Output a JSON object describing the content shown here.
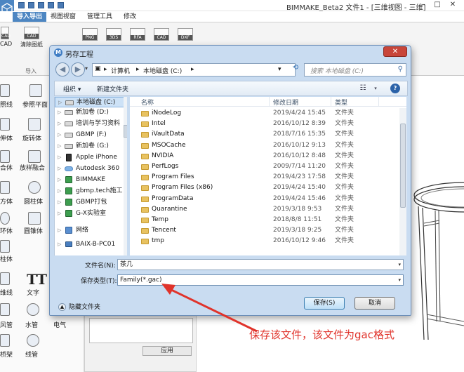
{
  "app": {
    "title": "BIMMAKE_Beta2 文件1 - [三维视图 - 三维]",
    "tabs": [
      "导入导出",
      "视图视窗",
      "管理工具",
      "修改"
    ],
    "active_tab": 0,
    "ribbon_buttons": [
      {
        "label": "CAD",
        "icon_tag": "CAD"
      },
      {
        "label": "清除图纸",
        "icon_tag": "CAD"
      },
      {
        "label": "",
        "icon_tag": "PNG"
      },
      {
        "label": "",
        "icon_tag": "3DS"
      },
      {
        "label": "",
        "icon_tag": "RFA"
      },
      {
        "label": "",
        "icon_tag": "CAD"
      },
      {
        "label": "",
        "icon_tag": "DXF"
      }
    ],
    "ribbon_group_label": "导入",
    "tools": [
      "照线",
      "参照平面",
      "伸体",
      "旋转体",
      "合体",
      "放样融合",
      "方体",
      "圆柱体",
      "环体",
      "圆锥体",
      "柱体",
      "维线",
      "文字",
      "风管",
      "水管",
      "电气",
      "桥架",
      "线管"
    ],
    "tt_glyph": "TT",
    "apply_button": "应用",
    "colors": {
      "accent": "#4d86c2",
      "annotation": "#e0332b"
    }
  },
  "dialog": {
    "title": "另存工程",
    "close_icon": "close-icon",
    "icon_letter": "M",
    "address_segments": [
      "计算机",
      "本地磁盘 (C:)"
    ],
    "search_placeholder": "搜索 本地磁盘 (C:)",
    "toolbar": {
      "organize": "组织 ▾",
      "new_folder": "新建文件夹"
    },
    "nav_items": [
      {
        "label": "本地磁盘 (C:)",
        "icon": "drive",
        "selected": true
      },
      {
        "label": "新加卷 (D:)",
        "icon": "drive"
      },
      {
        "label": "培训与学习资料",
        "icon": "drive"
      },
      {
        "label": "GBMP (F:)",
        "icon": "drive"
      },
      {
        "label": "新加卷 (G:)",
        "icon": "drive"
      },
      {
        "label": "Apple iPhone",
        "icon": "phone"
      },
      {
        "label": "Autodesk 360",
        "icon": "cloud"
      },
      {
        "label": "BIMMAKE",
        "icon": "app"
      },
      {
        "label": "gbmp.tech施工",
        "icon": "app"
      },
      {
        "label": "GBMP打包",
        "icon": "app"
      },
      {
        "label": "G-X实验室",
        "icon": "app"
      },
      {
        "label": "网络",
        "icon": "net"
      },
      {
        "label": "BAIX-B-PC01",
        "icon": "pc"
      }
    ],
    "columns": {
      "name": "名称",
      "date": "修改日期",
      "type": "类型"
    },
    "files": [
      {
        "name": "iNodeLog",
        "date": "2019/4/24 15:45",
        "type": "文件夹"
      },
      {
        "name": "Intel",
        "date": "2016/10/12 8:39",
        "type": "文件夹"
      },
      {
        "name": "iVaultData",
        "date": "2018/7/16 15:35",
        "type": "文件夹"
      },
      {
        "name": "MSOCache",
        "date": "2016/10/12 9:13",
        "type": "文件夹"
      },
      {
        "name": "NVIDIA",
        "date": "2016/10/12 8:48",
        "type": "文件夹"
      },
      {
        "name": "PerfLogs",
        "date": "2009/7/14 11:20",
        "type": "文件夹"
      },
      {
        "name": "Program Files",
        "date": "2019/4/23 17:58",
        "type": "文件夹"
      },
      {
        "name": "Program Files (x86)",
        "date": "2019/4/24 15:40",
        "type": "文件夹"
      },
      {
        "name": "ProgramData",
        "date": "2019/4/24 15:46",
        "type": "文件夹"
      },
      {
        "name": "Quarantine",
        "date": "2019/3/18 9:53",
        "type": "文件夹"
      },
      {
        "name": "Temp",
        "date": "2018/8/8 11:51",
        "type": "文件夹"
      },
      {
        "name": "Tencent",
        "date": "2019/3/18 9:25",
        "type": "文件夹"
      },
      {
        "name": "tmp",
        "date": "2016/10/12 9:46",
        "type": "文件夹"
      }
    ],
    "filename_label": "文件名(N):",
    "filename_value": "茶几",
    "filetype_label": "保存类型(T):",
    "filetype_value": "Family(*.gac)",
    "hide_folders": "隐藏文件夹",
    "save_button": "保存(S)",
    "cancel_button": "取消"
  },
  "annotation": "保存该文件，该文件为gac格式"
}
